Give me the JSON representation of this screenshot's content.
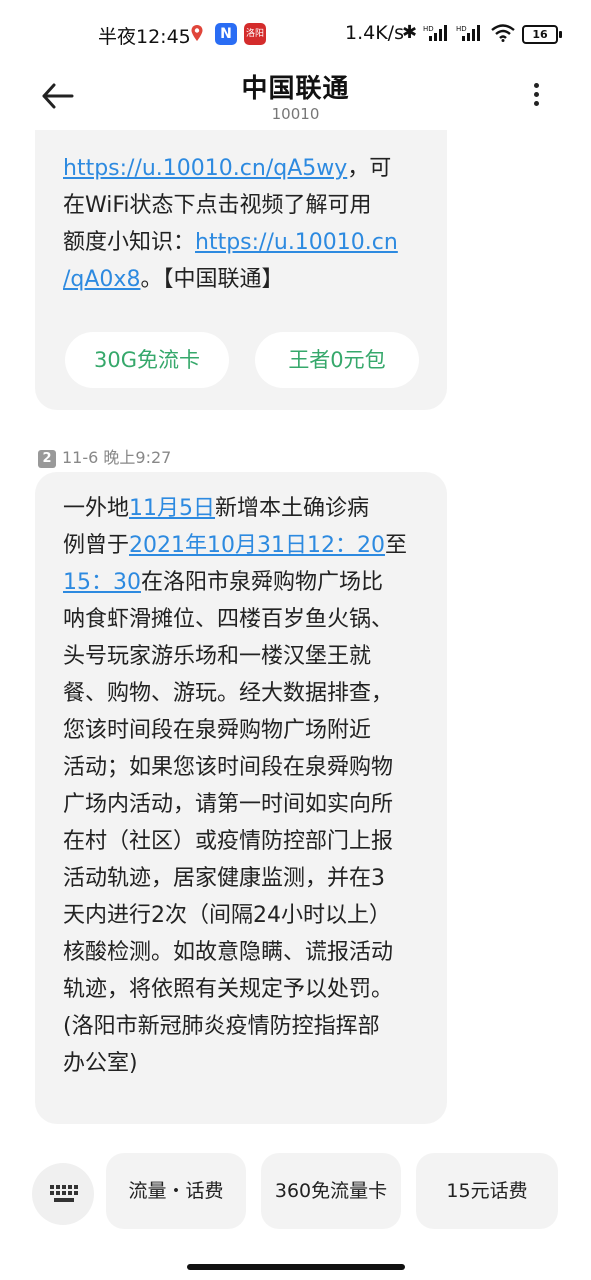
{
  "status_bar": {
    "time": "半夜12:45",
    "app1_label": "N",
    "app2_label": "洛阳",
    "net_speed": "1.4K/s",
    "bluetooth": "✱",
    "signal_tag": "HD",
    "battery": "16"
  },
  "header": {
    "title": "中国联通",
    "subtitle": "10010"
  },
  "messages": {
    "m1": {
      "line1_link": "https://u.10010.cn/qA5wy",
      "line1_text": "，可",
      "line2": "在WiFi状态下点击视频了解可用",
      "line3_text": "额度小知识：",
      "line3_link": "https://u.10010.cn",
      "line4_link": "/qA0x8",
      "line4_text": "。【中国联通】",
      "chip1": "30G免流卡",
      "chip2": "王者0元包"
    },
    "time_sim": "2",
    "time_label": "11-6 晚上9:27",
    "m2": {
      "l1a": "一外地",
      "l1link": "11月5日",
      "l1b": "新增本土确诊病",
      "l2a": "例曾于",
      "l2link": "2021年10月31日12：20",
      "l2b": "至",
      "l3link": "15：30",
      "l3b": "在洛阳市泉舜购物广场比",
      "l4": "呐食虾滑摊位、四楼百岁鱼火锅、",
      "l5": "头号玩家游乐场和一楼汉堡王就",
      "l6": "餐、购物、游玩。经大数据排查，",
      "l7": "您该时间段在泉舜购物广场附近",
      "l8": "活动；如果您该时间段在泉舜购物",
      "l9": "广场内活动，请第一时间如实向所",
      "l10": "在村（社区）或疫情防控部门上报",
      "l11": "活动轨迹，居家健康监测，并在3",
      "l12": "天内进行2次（间隔24小时以上）",
      "l13": "核酸检测。如故意隐瞒、谎报活动",
      "l14": "轨迹，将依照有关规定予以处罚。",
      "l15": "(洛阳市新冠肺炎疫情防控指挥部",
      "l16": "办公室)"
    }
  },
  "quick_actions": {
    "q1": "流量・话费",
    "q2": "360免流量卡",
    "q3": "15元话费"
  }
}
